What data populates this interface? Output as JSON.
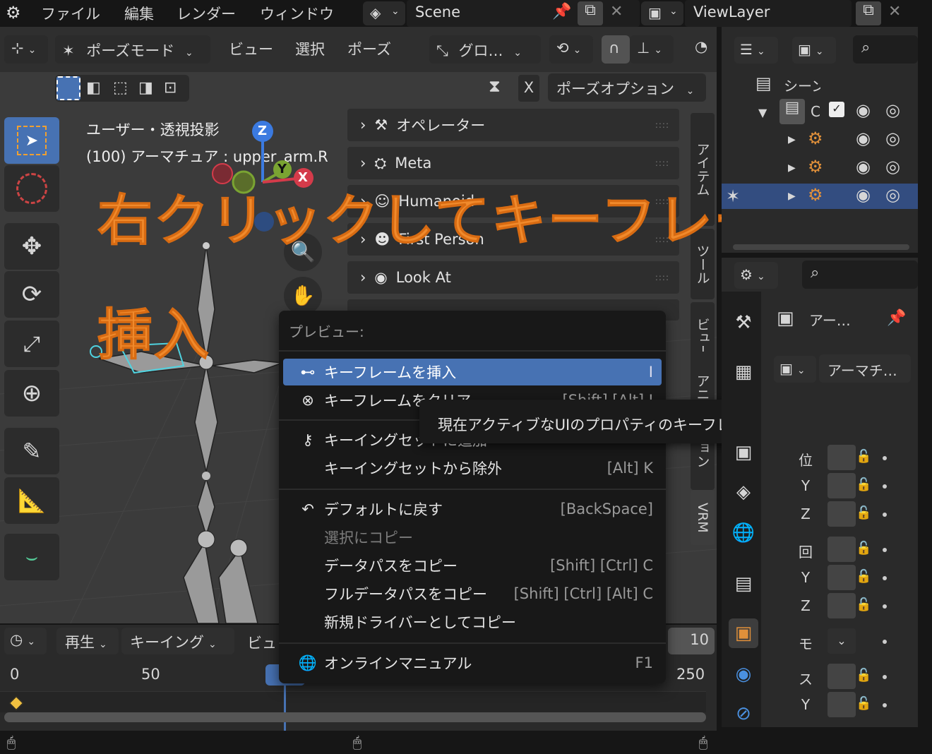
{
  "topbar": {
    "menus": [
      "ファイル",
      "編集",
      "レンダー",
      "ウィンドウ"
    ],
    "scene_name": "Scene",
    "view_layer": "ViewLayer"
  },
  "viewport_header": {
    "mode": "ポーズモード",
    "menus": [
      "ビュー",
      "選択",
      "ポーズ"
    ],
    "transform_orientation": "グロ…",
    "x_label": "X",
    "pose_options": "ポーズオプション"
  },
  "viewport_info": {
    "view_name": "ユーザー・透視投影",
    "object_info": "(100) アーマチュア : upper_arm.R"
  },
  "gizmo": {
    "z": "Z",
    "y": "Y",
    "x": "X"
  },
  "n_panel": {
    "items": [
      "オペレーター",
      "Meta",
      "Humanoid",
      "First Person",
      "Look At"
    ]
  },
  "side_tabs": [
    "アイテム",
    "ツール",
    "ビュー",
    "アニメーション",
    "VRM"
  ],
  "overlay": {
    "line1": "右クリックしてキーフレームを",
    "line2": "挿入"
  },
  "context_menu": {
    "title": "プレビュー:",
    "items": [
      {
        "label": "キーフレームを挿入",
        "shortcut": "I"
      },
      {
        "label": "キーフレームをクリア",
        "shortcut": "[Shift] [Alt] I"
      },
      {
        "label": "キーイングセットに追加",
        "shortcut": ""
      },
      {
        "label": "キーイングセットから除外",
        "shortcut": "[Alt] K"
      },
      {
        "label": "デフォルトに戻す",
        "shortcut": "[BackSpace]"
      },
      {
        "label": "選択にコピー",
        "shortcut": ""
      },
      {
        "label": "データパスをコピー",
        "shortcut": "[Shift] [Ctrl] C"
      },
      {
        "label": "フルデータパスをコピー",
        "shortcut": "[Shift] [Ctrl] [Alt] C"
      },
      {
        "label": "新規ドライバーとしてコピー",
        "shortcut": ""
      },
      {
        "label": "オンラインマニュアル",
        "shortcut": "F1"
      }
    ]
  },
  "tooltip": "現在アクティブなUIのプロパティのキーフレームを挿入します.",
  "timeline": {
    "playback": "再生",
    "keying": "キーイング",
    "view": "ビュ",
    "current_frame_partial": "10",
    "ticks": [
      "0",
      "50",
      "250"
    ]
  },
  "outliner": {
    "scene_label": "シーン",
    "collection_label": "C"
  },
  "properties": {
    "header_name": "アー…",
    "data_name": "アーマチ…",
    "rows": [
      "位",
      "Y",
      "Z",
      "回",
      "Y",
      "Z",
      "モ",
      "ス",
      "Y"
    ]
  },
  "colors": {
    "accent": "#4772b3",
    "overlay_orange": "#f08a2c",
    "bg": "#161616"
  }
}
